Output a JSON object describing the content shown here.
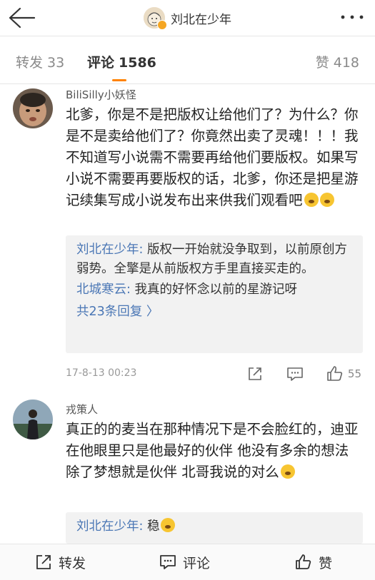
{
  "header": {
    "title": "刘北在少年",
    "back_icon": "arrow-left-icon",
    "more_icon": "more-dots-icon"
  },
  "tabs": [
    {
      "label": "转发",
      "count": "33"
    },
    {
      "label": "评论",
      "count": "1586",
      "active": true
    },
    {
      "label": "赞",
      "count": "418"
    }
  ],
  "comments": [
    {
      "user": "BiliSilly小妖怪",
      "text": "北爹，你是不是把版权让给他们了？为什么？你是不是卖给他们了？你竟然出卖了灵魂！！！我不知道写小说需不需要再给他们要版权。如果写小说不需要再要版权的话，北爹，你还是把星游记续集写成小说发布出来供我们观看吧",
      "replies": [
        {
          "user": "刘北在少年",
          "sep": ":",
          "text": " 版权一开始就没争取到，以前原创方弱势。全擎是从前版权方手里直接买走的。"
        },
        {
          "user": "北城寒云",
          "sep": ":",
          "text": " 我真的好怀念以前的星游记呀"
        }
      ],
      "more_replies": "共23条回复 〉",
      "time": "17-8-13 00:23",
      "likes": "55"
    },
    {
      "user": "戎策人",
      "text": "真正的的麦当在那种情况下是不会脸红的，迪亚在他眼里只是他最好的伙伴 他没有多余的想法 除了梦想就是伙伴  北哥我说的对么",
      "replies": [
        {
          "user": "刘北在少年",
          "sep": ":",
          "text": " 稳"
        }
      ]
    }
  ],
  "bottom_bar": {
    "repost": "转发",
    "comment": "评论",
    "like": "赞"
  },
  "colors": {
    "accent": "#ff8200",
    "link": "#4b77b5",
    "reply_bg": "#f2f2f2"
  }
}
